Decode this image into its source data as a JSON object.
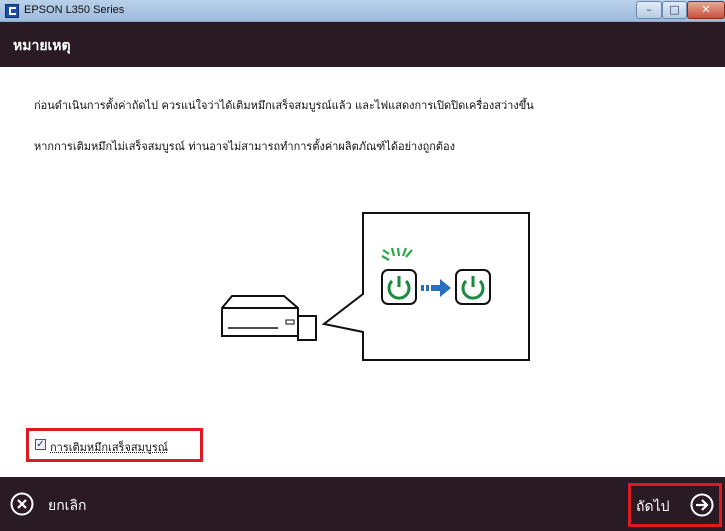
{
  "window": {
    "title": "EPSON L350 Series"
  },
  "header": {
    "title": "หมายเหตุ"
  },
  "body": {
    "line1": "ก่อนดำเนินการตั้งค่าถัดไป ควรแน่ใจว่าได้เติมหมึกเสร็จสมบูรณ์แล้ว และไฟแสดงการเปิดปิดเครื่องสว่างขึ้น",
    "line2": "หากการเติมหมึกไม่เสร็จสมบูรณ์ ท่านอาจไม่สามารถทำการตั้งค่าผลิตภัณฑ์ได้อย่างถูกต้อง"
  },
  "checkbox": {
    "label": "การเติมหมึกเสร็จสมบูรณ์",
    "checked": true
  },
  "footer": {
    "cancel_label": "ยกเลิก",
    "next_label": "ถัดไป"
  },
  "colors": {
    "header_bg": "#291a24",
    "highlight": "#e0191e",
    "power_green": "#1a8a3c",
    "arrow_blue": "#2a6fbf"
  }
}
